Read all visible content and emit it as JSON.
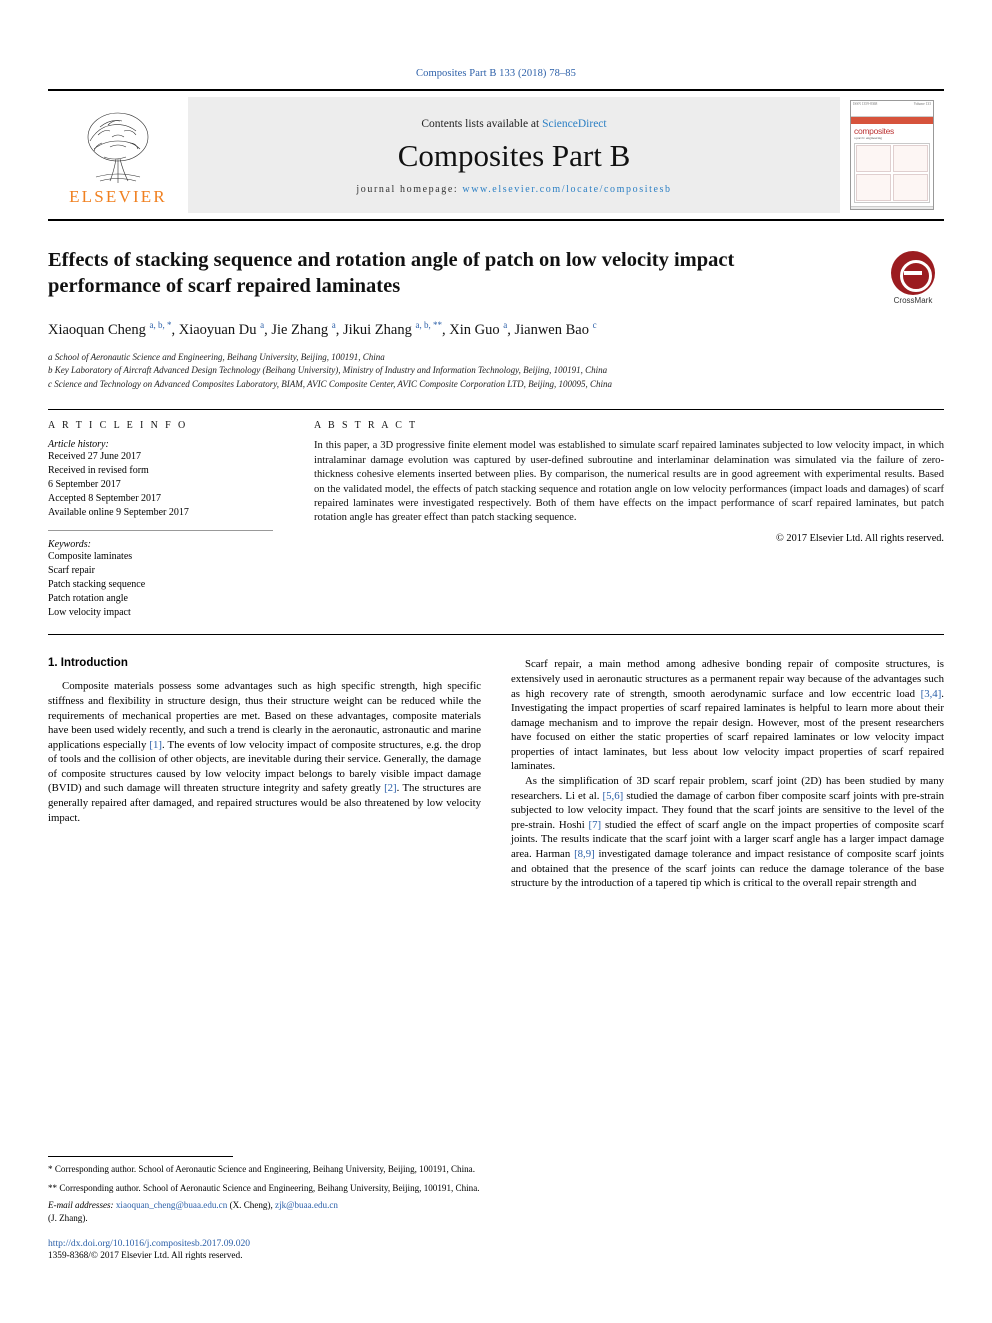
{
  "header": {
    "journal_ref": "Composites Part B 133 (2018) 78–85",
    "contents_prefix": "Contents lists available at ",
    "contents_link": "ScienceDirect",
    "journal_title": "Composites Part B",
    "homepage_prefix": "journal homepage: ",
    "homepage_url": "www.elsevier.com/locate/compositesb",
    "publisher": "ELSEVIER",
    "cover": {
      "brand": "composites",
      "sub": "a part b: engineering",
      "corner_left": "ISSN 1359-8368",
      "corner_right": "Volume 133"
    }
  },
  "article": {
    "title": "Effects of stacking sequence and rotation angle of patch on low velocity impact performance of scarf repaired laminates",
    "crossmark_label": "CrossMark",
    "authors_html": "Xiaoquan Cheng a, b, *, Xiaoyuan Du a, Jie Zhang a, Jikui Zhang a, b, **, Xin Guo a, Jianwen Bao c",
    "affiliations": [
      "a School of Aeronautic Science and Engineering, Beihang University, Beijing, 100191, China",
      "b Key Laboratory of Aircraft Advanced Design Technology (Beihang University), Ministry of Industry and Information Technology, Beijing, 100191, China",
      "c Science and Technology on Advanced Composites Laboratory, BIAM, AVIC Composite Center, AVIC Composite Corporation LTD, Beijing, 100095, China"
    ]
  },
  "info": {
    "heading": "A R T I C L E   I N F O",
    "history_label": "Article history:",
    "history": [
      "Received 27 June 2017",
      "Received in revised form",
      "6 September 2017",
      "Accepted 8 September 2017",
      "Available online 9 September 2017"
    ],
    "keywords_label": "Keywords:",
    "keywords": [
      "Composite laminates",
      "Scarf repair",
      "Patch stacking sequence",
      "Patch rotation angle",
      "Low velocity impact"
    ]
  },
  "abstract": {
    "heading": "A B S T R A C T",
    "text": "In this paper, a 3D progressive finite element model was established to simulate scarf repaired laminates subjected to low velocity impact, in which intralaminar damage evolution was captured by user-defined subroutine and interlaminar delamination was simulated via the failure of zero-thickness cohesive elements inserted between plies. By comparison, the numerical results are in good agreement with experimental results. Based on the validated model, the effects of patch stacking sequence and rotation angle on low velocity performances (impact loads and damages) of scarf repaired laminates were investigated respectively. Both of them have effects on the impact performance of scarf repaired laminates, but patch rotation angle has greater effect than patch stacking sequence.",
    "rights": "© 2017 Elsevier Ltd. All rights reserved."
  },
  "body": {
    "section_title": "1.  Introduction",
    "left_paragraphs": [
      "Composite materials possess some advantages such as high specific strength, high specific stiffness and flexibility in structure design, thus their structure weight can be reduced while the requirements of mechanical properties are met. Based on these advantages, composite materials have been used widely recently, and such a trend is clearly in the aeronautic, astronautic and marine applications especially [1]. The events of low velocity impact of composite structures, e.g. the drop of tools and the collision of other objects, are inevitable during their service. Generally, the damage of composite structures caused by low velocity impact belongs to barely visible impact damage (BVID) and such damage will threaten structure integrity and safety greatly [2]. The structures are generally repaired after damaged, and repaired structures would be also threatened by low velocity impact."
    ],
    "right_paragraphs": [
      "Scarf repair, a main method among adhesive bonding repair of composite structures, is extensively used in aeronautic structures as a permanent repair way because of the advantages such as high recovery rate of strength, smooth aerodynamic surface and low eccentric load [3,4]. Investigating the impact properties of scarf repaired laminates is helpful to learn more about their damage mechanism and to improve the repair design. However, most of the present researchers have focused on either the static properties of scarf repaired laminates or low velocity impact properties of intact laminates, but less about low velocity impact properties of scarf repaired laminates.",
      "As the simplification of 3D scarf repair problem, scarf joint (2D) has been studied by many researchers. Li et al. [5,6] studied the damage of carbon fiber composite scarf joints with pre-strain subjected to low velocity impact. They found that the scarf joints are sensitive to the level of the pre-strain. Hoshi [7] studied the effect of scarf angle on the impact properties of composite scarf joints. The results indicate that the scarf joint with a larger scarf angle has a larger impact damage area. Harman [8,9] investigated damage tolerance and impact resistance of composite scarf joints and obtained that the presence of the scarf joints can reduce the damage tolerance of the base structure by the introduction of a tapered tip which is critical to the overall repair strength and"
    ]
  },
  "footnotes": {
    "note1": "* Corresponding author. School of Aeronautic Science and Engineering, Beihang University, Beijing, 100191, China.",
    "note2": "** Corresponding author. School of Aeronautic Science and Engineering, Beihang University, Beijing, 100191, China.",
    "email_label": "E-mail addresses:",
    "email1": "xiaoquan_cheng@buaa.edu.cn",
    "email1_name": "(X. Cheng),",
    "email2": "zjk@buaa.edu.cn",
    "email2_name": "(J. Zhang).",
    "doi": "http://dx.doi.org/10.1016/j.compositesb.2017.09.020",
    "issn": "1359-8368/© 2017 Elsevier Ltd. All rights reserved."
  }
}
